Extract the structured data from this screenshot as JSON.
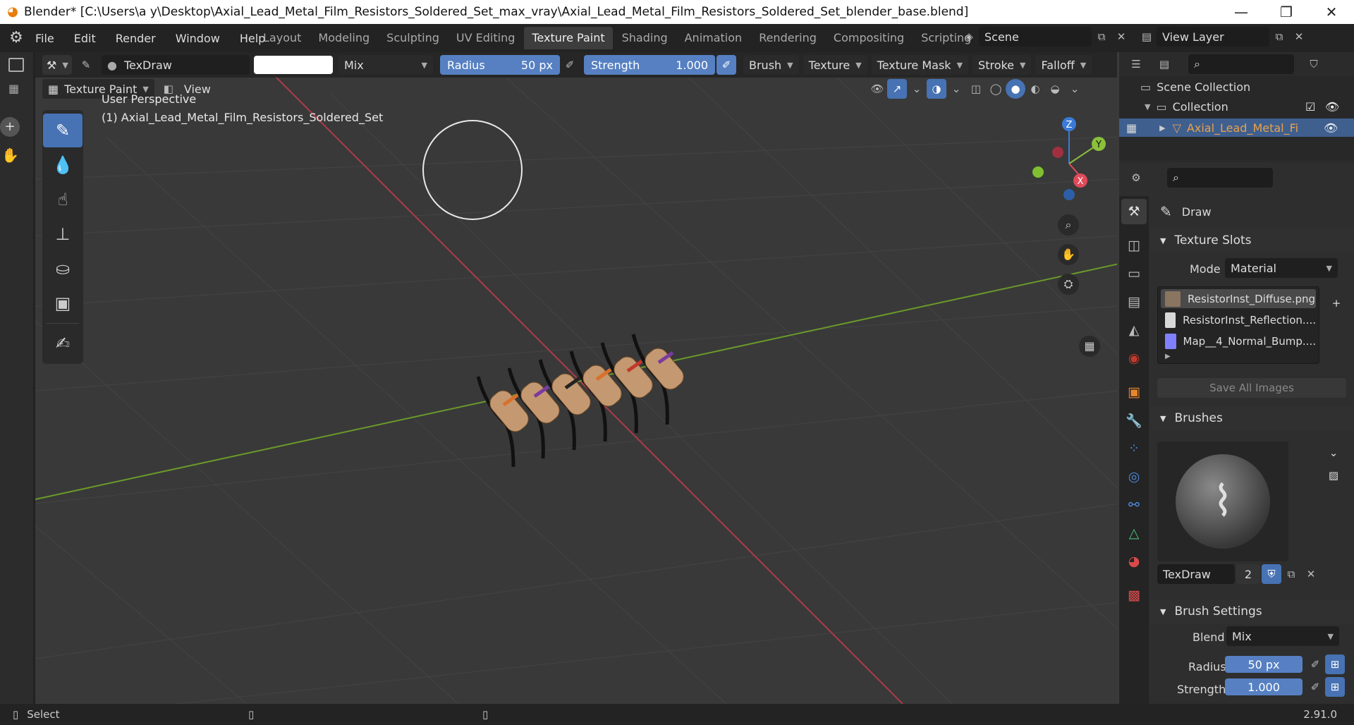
{
  "window": {
    "title": "Blender* [C:\\Users\\a y\\Desktop\\Axial_Lead_Metal_Film_Resistors_Soldered_Set_max_vray\\Axial_Lead_Metal_Film_Resistors_Soldered_Set_blender_base.blend]",
    "minimize": "—",
    "maximize": "❐",
    "close": "✕"
  },
  "menu": [
    "File",
    "Edit",
    "Render",
    "Window",
    "Help"
  ],
  "workspaces": [
    "Layout",
    "Modeling",
    "Sculpting",
    "UV Editing",
    "Texture Paint",
    "Shading",
    "Animation",
    "Rendering",
    "Compositing",
    "Scripting"
  ],
  "active_workspace": "Texture Paint",
  "add_workspace": "+",
  "scene": {
    "label": "Scene",
    "view_layer": "View Layer"
  },
  "tool_header": {
    "brush_name": "TexDraw",
    "blend": "Mix",
    "radius_label": "Radius",
    "radius_value": "50 px",
    "strength_label": "Strength",
    "strength_value": "1.000",
    "menus": [
      "Brush",
      "Texture",
      "Texture Mask",
      "Stroke",
      "Falloff"
    ]
  },
  "viewport_header": {
    "mode": "Texture Paint",
    "view": "View"
  },
  "viewport_text": {
    "perspective": "User Perspective",
    "object": "(1) Axial_Lead_Metal_Film_Resistors_Soldered_Set"
  },
  "tools": [
    "draw-tool",
    "soften-tool",
    "smear-tool",
    "clone-tool",
    "fill-tool",
    "mask-tool",
    "annotate-tool"
  ],
  "gizmo": {
    "x": "X",
    "y": "Y",
    "z": "Z"
  },
  "outliner": {
    "scene_collection": "Scene Collection",
    "collection": "Collection",
    "object": "Axial_Lead_Metal_Fi"
  },
  "properties": {
    "brush_title": "Draw",
    "texture_slots": {
      "header": "Texture Slots",
      "mode_label": "Mode",
      "mode_value": "Material",
      "slots": [
        "ResistorInst_Diffuse.png",
        "ResistorInst_Reflection....",
        "Map__4_Normal_Bump...."
      ],
      "save_all": "Save All Images"
    },
    "brushes": {
      "header": "Brushes",
      "name": "TexDraw",
      "users": "2"
    },
    "brush_settings": {
      "header": "Brush Settings",
      "blend_label": "Blend",
      "blend_value": "Mix",
      "radius_label": "Radius",
      "radius_value": "50 px",
      "strength_label": "Strength",
      "strength_value": "1.000"
    }
  },
  "status": {
    "select": "Select",
    "version": "2.91.0"
  },
  "colors": {
    "accent": "#4772b3",
    "slider": "#5680c2",
    "x_axis": "#b03a48",
    "y_axis": "#6a9a2a",
    "selected_object": "#e8a24c"
  }
}
